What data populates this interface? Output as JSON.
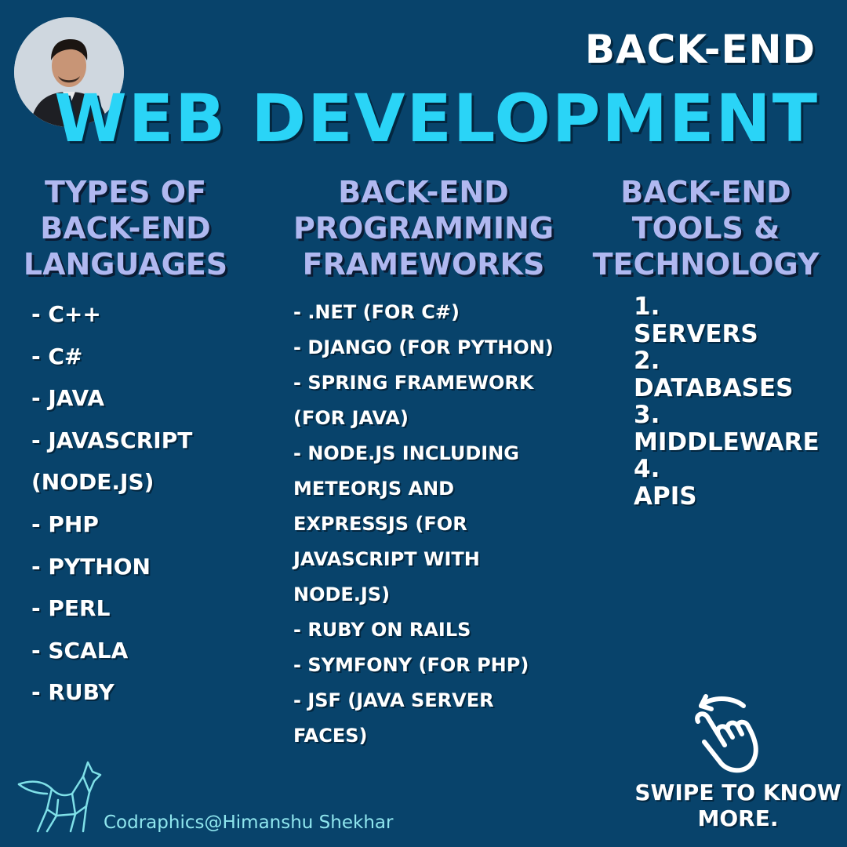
{
  "header": {
    "top_title": "BACK-END",
    "main_title": "WEB DEVELOPMENT"
  },
  "columns": [
    {
      "heading": "TYPES OF BACK-END LANGUAGES",
      "items": [
        "- C++",
        "- C#",
        "- JAVA",
        "- JAVASCRIPT (NODE.JS)",
        "- PHP",
        "- PYTHON",
        "- PERL",
        "- SCALA",
        "- RUBY"
      ]
    },
    {
      "heading": "BACK-END PROGRAMMING FRAMEWORKS",
      "items": [
        "- .NET (FOR C#)",
        "- DJANGO (FOR PYTHON)",
        "- SPRING FRAMEWORK (FOR JAVA)",
        "- NODE.JS INCLUDING METEORJS AND EXPRESSJS (FOR JAVASCRIPT WITH NODE.JS)",
        "- RUBY ON RAILS",
        "- SYMFONY (FOR PHP)",
        "- JSF (JAVA SERVER FACES)"
      ]
    },
    {
      "heading": "BACK-END TOOLS & TECHNOLOGY",
      "items": [
        "1.",
        "SERVERS",
        "2.",
        "DATABASES",
        "3.",
        "MIDDLEWARE",
        "4.",
        "APIS"
      ]
    }
  ],
  "footer": {
    "swipe_text": "SWIPE TO KNOW MORE.",
    "credit": "Codraphics@Himanshu Shekhar"
  },
  "icons": {
    "avatar": "author-photo",
    "swipe": "swipe-hand-icon",
    "logo": "fox-logo-icon"
  },
  "colors": {
    "background": "#08436b",
    "accent": "#2ad4f7",
    "heading": "#b0b8f0",
    "credit": "#8fe6ee"
  }
}
